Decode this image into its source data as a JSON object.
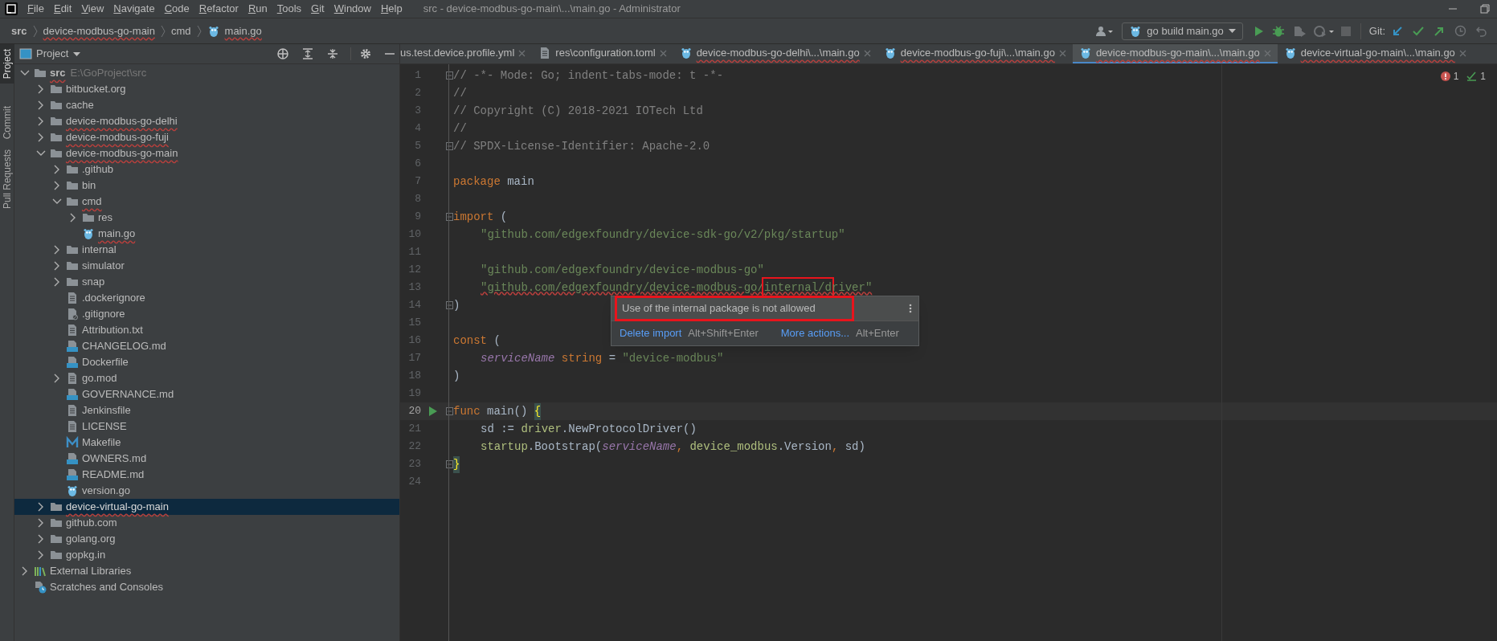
{
  "window": {
    "title": "src - device-modbus-go-main\\...\\main.go - Administrator"
  },
  "menu": [
    "File",
    "Edit",
    "View",
    "Navigate",
    "Code",
    "Refactor",
    "Run",
    "Tools",
    "Git",
    "Window",
    "Help"
  ],
  "breadcrumbs": [
    {
      "label": "src",
      "kind": "folder",
      "error": false,
      "bold": true
    },
    {
      "label": "device-modbus-go-main",
      "kind": "folder",
      "error": true,
      "bold": false
    },
    {
      "label": "cmd",
      "kind": "folder",
      "error": false,
      "bold": false
    },
    {
      "label": "main.go",
      "kind": "go",
      "error": true,
      "bold": false
    }
  ],
  "run_config": {
    "label": "go build main.go"
  },
  "git_label": "Git:",
  "side_tools": [
    {
      "label": "Project",
      "selected": true
    },
    {
      "label": "Commit",
      "selected": false
    },
    {
      "label": "Pull Requests",
      "selected": false
    }
  ],
  "project_panel": {
    "title": "Project",
    "tree": [
      {
        "label": "src",
        "path": "E:\\GoProject\\src",
        "kind": "folder",
        "bold": true,
        "error": true,
        "expanded": true,
        "selected": false,
        "children": [
          {
            "label": "bitbucket.org",
            "kind": "folder",
            "error": false,
            "expanded": false,
            "selected": false
          },
          {
            "label": "cache",
            "kind": "folder",
            "error": false,
            "expanded": false,
            "selected": false
          },
          {
            "label": "device-modbus-go-delhi",
            "kind": "folder",
            "error": true,
            "expanded": false,
            "selected": false
          },
          {
            "label": "device-modbus-go-fuji",
            "kind": "folder",
            "error": true,
            "expanded": false,
            "selected": false
          },
          {
            "label": "device-modbus-go-main",
            "kind": "folder",
            "error": true,
            "expanded": true,
            "selected": false,
            "children": [
              {
                "label": ".github",
                "kind": "folder",
                "error": false,
                "expanded": false,
                "selected": false
              },
              {
                "label": "bin",
                "kind": "folder",
                "error": false,
                "expanded": false,
                "selected": false
              },
              {
                "label": "cmd",
                "kind": "folder",
                "error": true,
                "expanded": true,
                "selected": false,
                "children": [
                  {
                    "label": "res",
                    "kind": "folder",
                    "error": false,
                    "expanded": false,
                    "selected": false
                  },
                  {
                    "label": "main.go",
                    "kind": "go",
                    "error": true,
                    "selected": false
                  }
                ]
              },
              {
                "label": "internal",
                "kind": "folder",
                "error": false,
                "expanded": false,
                "selected": false
              },
              {
                "label": "simulator",
                "kind": "folder",
                "error": false,
                "expanded": false,
                "selected": false
              },
              {
                "label": "snap",
                "kind": "folder",
                "error": false,
                "expanded": false,
                "selected": false
              },
              {
                "label": ".dockerignore",
                "kind": "file",
                "error": false,
                "selected": false
              },
              {
                "label": ".gitignore",
                "kind": "ignore",
                "error": false,
                "selected": false
              },
              {
                "label": "Attribution.txt",
                "kind": "file",
                "error": false,
                "selected": false
              },
              {
                "label": "CHANGELOG.md",
                "kind": "md",
                "error": false,
                "selected": false
              },
              {
                "label": "Dockerfile",
                "kind": "docker",
                "error": false,
                "selected": false
              },
              {
                "label": "go.mod",
                "kind": "file",
                "error": false,
                "expanded": false,
                "selected": false
              },
              {
                "label": "GOVERNANCE.md",
                "kind": "md",
                "error": false,
                "selected": false
              },
              {
                "label": "Jenkinsfile",
                "kind": "file",
                "error": false,
                "selected": false
              },
              {
                "label": "LICENSE",
                "kind": "file",
                "error": false,
                "selected": false
              },
              {
                "label": "Makefile",
                "kind": "make",
                "error": false,
                "selected": false
              },
              {
                "label": "OWNERS.md",
                "kind": "md",
                "error": false,
                "selected": false
              },
              {
                "label": "README.md",
                "kind": "md",
                "error": false,
                "selected": false
              },
              {
                "label": "version.go",
                "kind": "go",
                "error": false,
                "selected": false
              }
            ]
          },
          {
            "label": "device-virtual-go-main",
            "kind": "folder",
            "error": true,
            "expanded": false,
            "selected": true
          },
          {
            "label": "github.com",
            "kind": "folder",
            "error": false,
            "expanded": false,
            "selected": false
          },
          {
            "label": "golang.org",
            "kind": "folder",
            "error": false,
            "expanded": false,
            "selected": false
          },
          {
            "label": "gopkg.in",
            "kind": "folder",
            "error": false,
            "expanded": false,
            "selected": false
          }
        ]
      },
      {
        "label": "External Libraries",
        "kind": "libs",
        "error": false,
        "expanded": false,
        "selected": false
      },
      {
        "label": "Scratches and Consoles",
        "kind": "scratch",
        "error": false,
        "selected": false
      }
    ]
  },
  "tabs": [
    {
      "label": "us.test.device.profile.yml",
      "kind": "cut",
      "error": false,
      "selected": false
    },
    {
      "label": "res\\configuration.toml",
      "kind": "file",
      "error": false,
      "selected": false
    },
    {
      "label": "device-modbus-go-delhi\\...\\main.go",
      "kind": "go",
      "error": true,
      "selected": false
    },
    {
      "label": "device-modbus-go-fuji\\...\\main.go",
      "kind": "go",
      "error": true,
      "selected": false
    },
    {
      "label": "device-modbus-go-main\\...\\main.go",
      "kind": "go",
      "error": true,
      "selected": true
    },
    {
      "label": "device-virtual-go-main\\...\\main.go",
      "kind": "go",
      "error": true,
      "selected": false
    }
  ],
  "inspections": {
    "errors": "1",
    "ok": "1"
  },
  "editor": {
    "lines": [
      {
        "number": "1",
        "fold": true,
        "current": false,
        "run": false,
        "tokens": [
          {
            "kind": "comment",
            "text": "// -*- Mode: Go; indent-tabs-mode: t -*-"
          }
        ]
      },
      {
        "number": "2",
        "fold": false,
        "current": false,
        "run": false,
        "tokens": [
          {
            "kind": "comment",
            "text": "//"
          }
        ]
      },
      {
        "number": "3",
        "fold": false,
        "current": false,
        "run": false,
        "tokens": [
          {
            "kind": "comment",
            "text": "// Copyright (C) 2018-2021 IOTech Ltd"
          }
        ]
      },
      {
        "number": "4",
        "fold": false,
        "current": false,
        "run": false,
        "tokens": [
          {
            "kind": "comment",
            "text": "//"
          }
        ]
      },
      {
        "number": "5",
        "fold": true,
        "current": false,
        "run": false,
        "tokens": [
          {
            "kind": "comment",
            "text": "// SPDX-License-Identifier: Apache-2.0"
          }
        ]
      },
      {
        "number": "6",
        "fold": false,
        "current": false,
        "run": false
      },
      {
        "number": "7",
        "fold": false,
        "current": false,
        "run": false,
        "tokens": [
          {
            "kind": "keyword",
            "text": "package "
          },
          {
            "kind": "plain",
            "text": "main"
          }
        ]
      },
      {
        "number": "8",
        "fold": false,
        "current": false,
        "run": false
      },
      {
        "number": "9",
        "fold": true,
        "current": false,
        "run": false,
        "tokens": [
          {
            "kind": "keyword",
            "text": "import "
          },
          {
            "kind": "plain",
            "text": "("
          }
        ]
      },
      {
        "number": "10",
        "fold": false,
        "indented": true,
        "current": false,
        "run": false,
        "tokens": [
          {
            "kind": "string",
            "text": "\"github.com/edgexfoundry/device-sdk-go/v2/pkg/startup\""
          }
        ]
      },
      {
        "number": "11",
        "fold": false,
        "current": false,
        "run": false
      },
      {
        "number": "12",
        "fold": false,
        "indented": true,
        "current": false,
        "run": false,
        "tokens": [
          {
            "kind": "string",
            "text": "\"github.com/edgexfoundry/device-modbus-go\""
          }
        ]
      },
      {
        "number": "13",
        "fold": false,
        "indented": true,
        "current": false,
        "run": false,
        "tokens": [
          {
            "kind": "string",
            "text": "\"github.com/edgexfoundry/device-modbus-go/",
            "error": true
          },
          {
            "kind": "string",
            "text": "internal/d",
            "error": true,
            "boxed": true
          },
          {
            "kind": "string",
            "text": "river\"",
            "error": true
          }
        ]
      },
      {
        "number": "14",
        "fold": true,
        "current": false,
        "run": false,
        "tokens": [
          {
            "kind": "plain",
            "text": ")"
          }
        ]
      },
      {
        "number": "15",
        "fold": false,
        "current": false,
        "run": false
      },
      {
        "number": "16",
        "fold": false,
        "current": false,
        "run": false,
        "tokens": [
          {
            "kind": "keyword",
            "text": "const "
          },
          {
            "kind": "plain",
            "text": "("
          }
        ]
      },
      {
        "number": "17",
        "fold": false,
        "indented": true,
        "current": false,
        "run": false,
        "tokens": [
          {
            "kind": "param",
            "text": "serviceName"
          },
          {
            "kind": "keyword",
            "text": " string"
          },
          {
            "kind": "plain",
            "text": " = "
          },
          {
            "kind": "string",
            "text": "\"device-modbus\""
          }
        ]
      },
      {
        "number": "18",
        "fold": false,
        "current": false,
        "run": false,
        "tokens": [
          {
            "kind": "plain",
            "text": ")"
          }
        ]
      },
      {
        "number": "19",
        "fold": false,
        "current": false,
        "run": false
      },
      {
        "number": "20",
        "fold": true,
        "current": true,
        "run": true,
        "tokens": [
          {
            "kind": "keyword",
            "text": "func "
          },
          {
            "kind": "plain",
            "text": "main() "
          },
          {
            "kind": "brace",
            "text": "{"
          }
        ]
      },
      {
        "number": "21",
        "fold": false,
        "indented": true,
        "current": false,
        "run": false,
        "tokens": [
          {
            "kind": "plain",
            "text": "sd := "
          },
          {
            "kind": "pkg",
            "text": "driver"
          },
          {
            "kind": "plain",
            "text": ".NewProtocolDriver()"
          }
        ]
      },
      {
        "number": "22",
        "fold": false,
        "indented": true,
        "current": false,
        "run": false,
        "tokens": [
          {
            "kind": "pkg",
            "text": "startup"
          },
          {
            "kind": "plain",
            "text": ".Bootstrap("
          },
          {
            "kind": "param",
            "text": "serviceName"
          },
          {
            "kind": "punct",
            "text": ", "
          },
          {
            "kind": "pkg",
            "text": "device_modbus"
          },
          {
            "kind": "plain",
            "text": ".Version"
          },
          {
            "kind": "punct",
            "text": ", "
          },
          {
            "kind": "plain",
            "text": "sd)"
          }
        ]
      },
      {
        "number": "23",
        "fold": true,
        "current": false,
        "run": false,
        "tokens": [
          {
            "kind": "brace",
            "text": "}"
          }
        ]
      },
      {
        "number": "24",
        "fold": false,
        "current": false,
        "run": false
      }
    ]
  },
  "popup": {
    "message": "Use of the internal package is not allowed",
    "message_boxed": true,
    "actions": [
      {
        "label": "Delete import",
        "shortcut": "Alt+Shift+Enter"
      },
      {
        "label": "More actions...",
        "shortcut": "Alt+Enter"
      }
    ]
  }
}
